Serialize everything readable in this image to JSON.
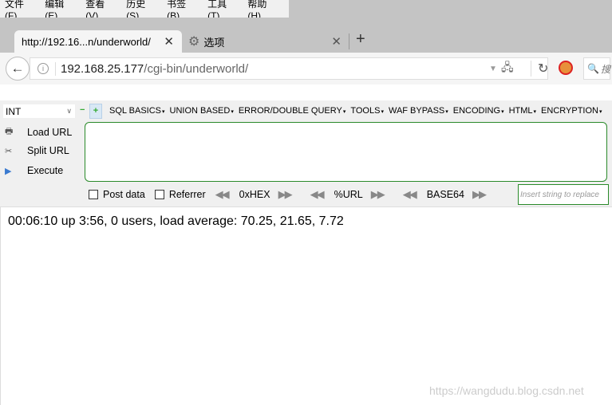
{
  "menubar": [
    "文件(F)",
    "编辑(E)",
    "查看(V)",
    "历史(S)",
    "书签(B)",
    "工具(T)",
    "帮助(H)"
  ],
  "tabs": [
    {
      "title": "http://192.16...n/underworld/",
      "active": true
    },
    {
      "title": "选项",
      "icon": "gear-icon"
    }
  ],
  "url": {
    "host": "192.168.25.177",
    "path": "/cgi-bin/underworld/"
  },
  "search": {
    "placeholder": "搜"
  },
  "hackbar": {
    "select_value": "INT",
    "menus": [
      "SQL BASICS",
      "UNION BASED",
      "ERROR/DOUBLE QUERY",
      "TOOLS",
      "WAF BYPASS",
      "ENCODING",
      "HTML",
      "ENCRYPTION"
    ],
    "load_url": "Load URL",
    "split_url": "Split URL",
    "execute": "Execute",
    "post_data": "Post data",
    "referrer": "Referrer",
    "hex": "0xHEX",
    "url": "%URL",
    "base64": "BASE64",
    "insert_placeholder": "Insert string to replace"
  },
  "output": "00:06:10 up 3:56, 0 users, load average: 70.25, 21.65, 7.72",
  "watermark": "https://wangdudu.blog.csdn.net"
}
